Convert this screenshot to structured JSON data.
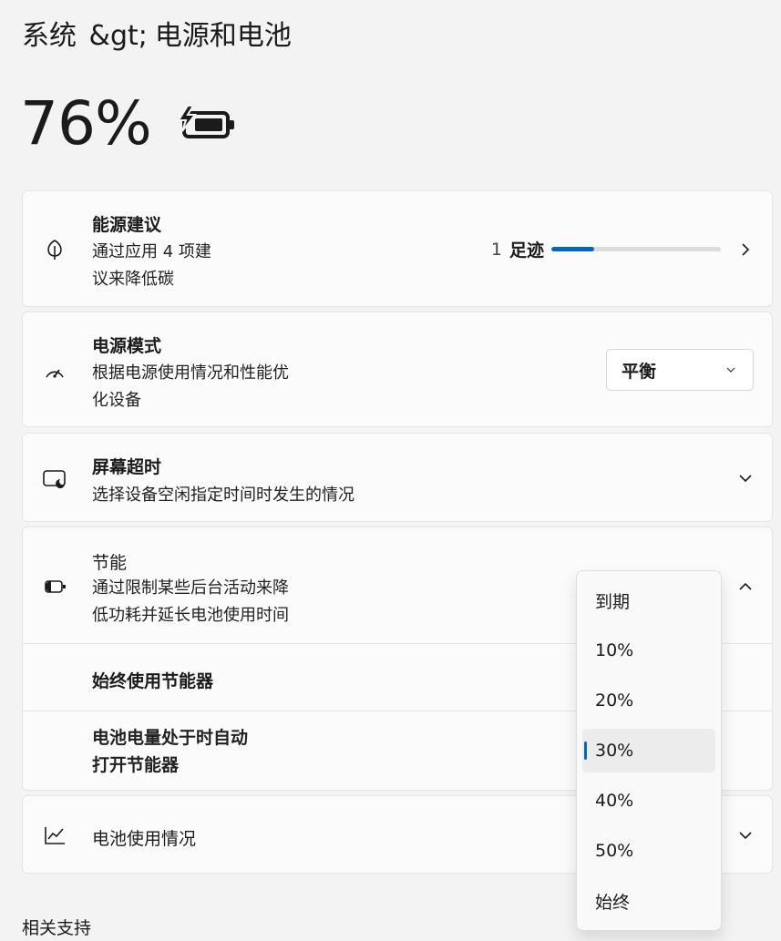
{
  "breadcrumb": {
    "parent": "系统",
    "separator": "&gt;",
    "current": "电源和电池"
  },
  "battery": {
    "percent_text": "76%",
    "icon": "battery-charging-icon"
  },
  "energy_recommendations": {
    "icon": "leaf-icon",
    "title": "能源建议",
    "desc_line1": "通过应用 4 项建",
    "desc_line2": "议来降低碳",
    "footprint_count": "1",
    "footprint_label": "足迹",
    "progress_fraction": 0.25
  },
  "power_mode": {
    "icon": "gauge-icon",
    "title": "电源模式",
    "desc_line1": "根据电源使用情况和性能优",
    "desc_line2": "化设备",
    "selected": "平衡"
  },
  "screen_timeout": {
    "icon": "screen-sleep-icon",
    "title": "屏幕超时",
    "desc": "选择设备空闲指定时间时发生的情况"
  },
  "energy_saver": {
    "icon": "battery-saver-icon",
    "title": "节能",
    "desc_line1": "通过限制某些后台活动来降",
    "desc_line2": "低功耗并延长电池使用时间",
    "always_use_label": "始终使用节能器",
    "auto_line1": "电池电量处于时自动",
    "auto_line2": "打开节能器"
  },
  "battery_usage": {
    "icon": "chart-icon",
    "title": "电池使用情况"
  },
  "dropdown": {
    "options": [
      "到期",
      "10%",
      "20%",
      "30%",
      "40%",
      "50%",
      "始终"
    ],
    "selected_index": 3
  },
  "related": {
    "label": "相关支持"
  },
  "colors": {
    "accent": "#0067c0"
  }
}
